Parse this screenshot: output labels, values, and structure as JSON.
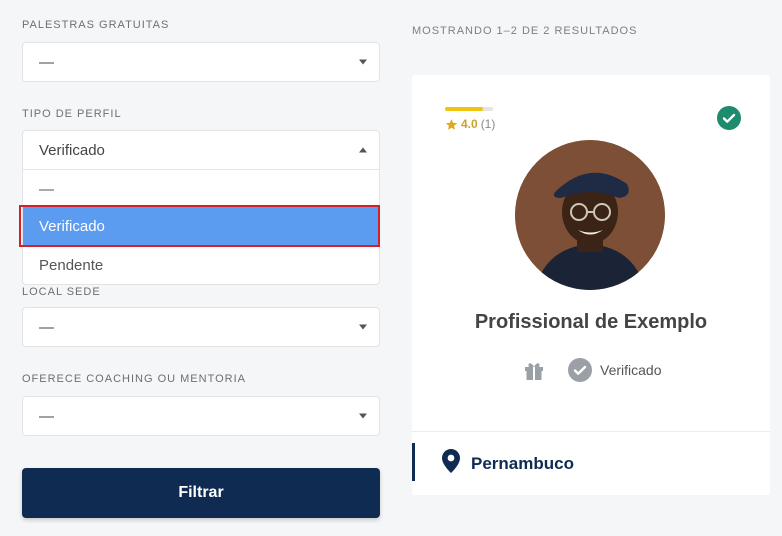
{
  "filters": {
    "palestras": {
      "label": "PALESTRAS GRATUITAS",
      "value": "—"
    },
    "tipo_perfil": {
      "label": "TIPO DE PERFIL",
      "value": "Verificado",
      "options": [
        "—",
        "Verificado",
        "Pendente"
      ],
      "selected_index": 1
    },
    "local_sede": {
      "label": "LOCAL SEDE",
      "value": "—"
    },
    "coaching": {
      "label": "OFERECE COACHING OU MENTORIA",
      "value": "—"
    },
    "submit_label": "Filtrar"
  },
  "results": {
    "summary": "MOSTRANDO 1–2 DE 2 RESULTADOS",
    "card": {
      "rating_score": "4.0",
      "rating_count": "(1)",
      "rating_fraction": 0.8,
      "name": "Profissional de Exemplo",
      "status": "Verificado",
      "location": "Pernambuco"
    }
  },
  "colors": {
    "primary": "#0f2b52",
    "selected_option": "#5b9bf0",
    "highlight_border": "#d3202c",
    "verified_green": "#1e8a6e",
    "star": "#f1c40f"
  }
}
